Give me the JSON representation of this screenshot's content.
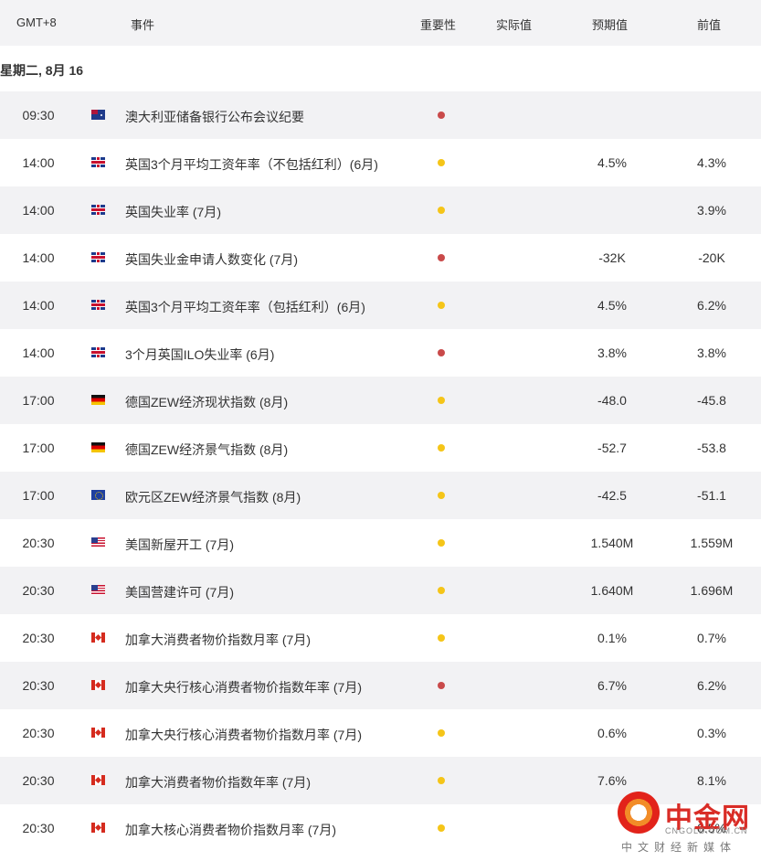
{
  "header": {
    "timezone": "GMT+8",
    "event": "事件",
    "importance": "重要性",
    "actual": "实际值",
    "forecast": "预期值",
    "previous": "前值"
  },
  "date_label": "星期二, 8月 16",
  "importance_colors": {
    "high": "#c94a4a",
    "medium": "#f5c518"
  },
  "rows": [
    {
      "time": "09:30",
      "flag": "australia-flag-icon",
      "event": "澳大利亚储备银行公布会议纪要",
      "importance": "high",
      "actual": "",
      "forecast": "",
      "previous": ""
    },
    {
      "time": "14:00",
      "flag": "uk-flag-icon",
      "event": "英国3个月平均工资年率（不包括红利）(6月)",
      "importance": "medium",
      "actual": "",
      "forecast": "4.5%",
      "previous": "4.3%"
    },
    {
      "time": "14:00",
      "flag": "uk-flag-icon",
      "event": "英国失业率 (7月)",
      "importance": "medium",
      "actual": "",
      "forecast": "",
      "previous": "3.9%"
    },
    {
      "time": "14:00",
      "flag": "uk-flag-icon",
      "event": "英国失业金申请人数变化 (7月)",
      "importance": "high",
      "actual": "",
      "forecast": "-32K",
      "previous": "-20K"
    },
    {
      "time": "14:00",
      "flag": "uk-flag-icon",
      "event": "英国3个月平均工资年率（包括红利）(6月)",
      "importance": "medium",
      "actual": "",
      "forecast": "4.5%",
      "previous": "6.2%"
    },
    {
      "time": "14:00",
      "flag": "uk-flag-icon",
      "event": "3个月英国ILO失业率 (6月)",
      "importance": "high",
      "actual": "",
      "forecast": "3.8%",
      "previous": "3.8%"
    },
    {
      "time": "17:00",
      "flag": "germany-flag-icon",
      "event": "德国ZEW经济现状指数 (8月)",
      "importance": "medium",
      "actual": "",
      "forecast": "-48.0",
      "previous": "-45.8"
    },
    {
      "time": "17:00",
      "flag": "germany-flag-icon",
      "event": "德国ZEW经济景气指数 (8月)",
      "importance": "medium",
      "actual": "",
      "forecast": "-52.7",
      "previous": "-53.8"
    },
    {
      "time": "17:00",
      "flag": "eu-flag-icon",
      "event": "欧元区ZEW经济景气指数 (8月)",
      "importance": "medium",
      "actual": "",
      "forecast": "-42.5",
      "previous": "-51.1"
    },
    {
      "time": "20:30",
      "flag": "us-flag-icon",
      "event": "美国新屋开工 (7月)",
      "importance": "medium",
      "actual": "",
      "forecast": "1.540M",
      "previous": "1.559M"
    },
    {
      "time": "20:30",
      "flag": "us-flag-icon",
      "event": "美国营建许可 (7月)",
      "importance": "medium",
      "actual": "",
      "forecast": "1.640M",
      "previous": "1.696M"
    },
    {
      "time": "20:30",
      "flag": "canada-flag-icon",
      "event": "加拿大消费者物价指数月率 (7月)",
      "importance": "medium",
      "actual": "",
      "forecast": "0.1%",
      "previous": "0.7%"
    },
    {
      "time": "20:30",
      "flag": "canada-flag-icon",
      "event": "加拿大央行核心消费者物价指数年率 (7月)",
      "importance": "high",
      "actual": "",
      "forecast": "6.7%",
      "previous": "6.2%"
    },
    {
      "time": "20:30",
      "flag": "canada-flag-icon",
      "event": "加拿大央行核心消费者物价指数月率 (7月)",
      "importance": "medium",
      "actual": "",
      "forecast": "0.6%",
      "previous": "0.3%"
    },
    {
      "time": "20:30",
      "flag": "canada-flag-icon",
      "event": "加拿大消费者物价指数年率 (7月)",
      "importance": "medium",
      "actual": "",
      "forecast": "7.6%",
      "previous": "8.1%"
    },
    {
      "time": "20:30",
      "flag": "canada-flag-icon",
      "event": "加拿大核心消费者物价指数月率 (7月)",
      "importance": "medium",
      "actual": "",
      "forecast": "",
      "previous": "0.5%"
    }
  ],
  "watermark": {
    "title": "中金网",
    "url": "CNGOLD.COM.CN",
    "subtitle": "中文财经新媒体"
  }
}
